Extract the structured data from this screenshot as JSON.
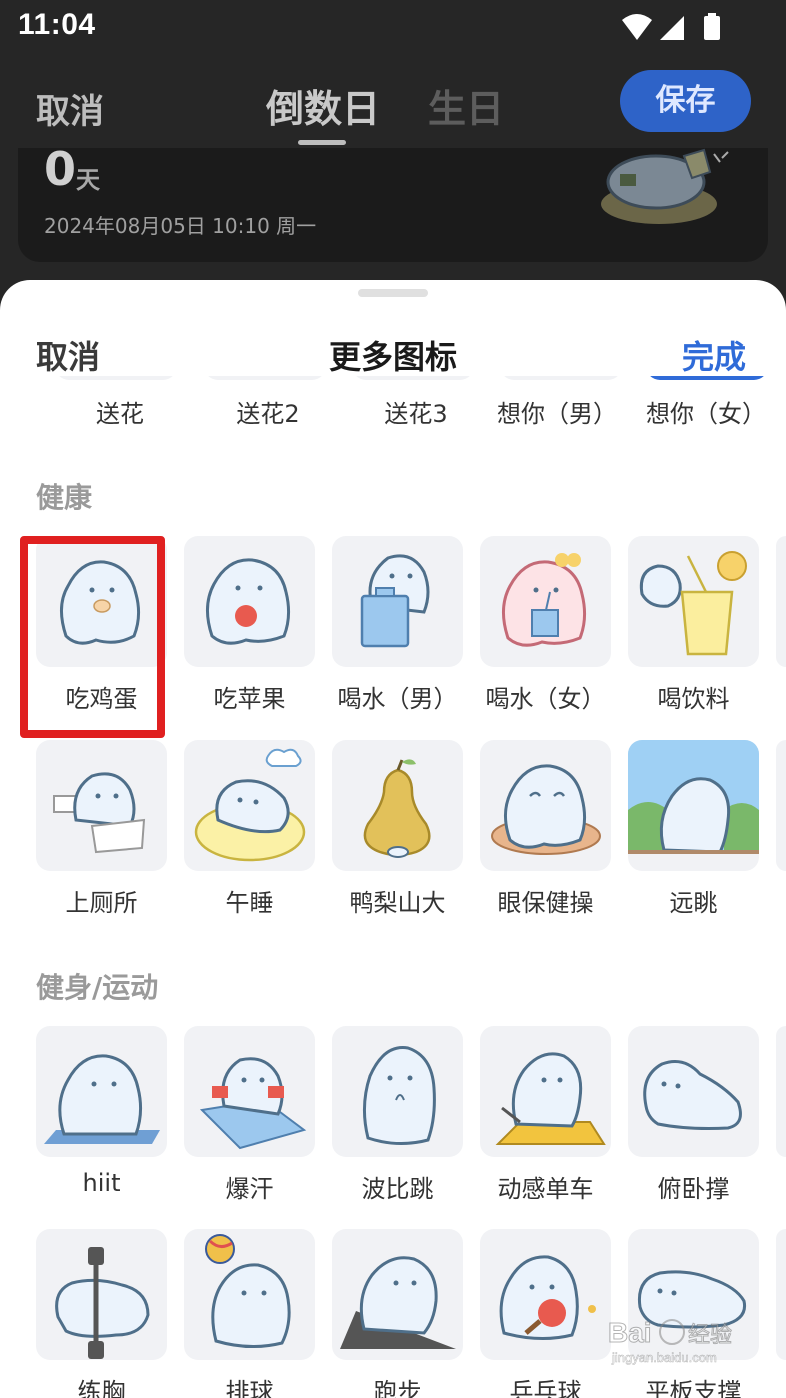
{
  "status": {
    "time": "11:04"
  },
  "topbar": {
    "cancel": "取消",
    "tabs": [
      "倒数日",
      "生日"
    ],
    "save": "保存"
  },
  "card": {
    "number": "0",
    "unit": "天",
    "date": "2024年08月05日  10:10  周一"
  },
  "sheet": {
    "cancel": "取消",
    "title": "更多图标",
    "done": "完成",
    "top_row_labels": [
      "送花",
      "送花2",
      "送花3",
      "想你（男）",
      "想你（女）"
    ],
    "sections": [
      {
        "title": "健康",
        "items": [
          "吃鸡蛋",
          "吃苹果",
          "喝水（男）",
          "喝水（女）",
          "喝饮料",
          "上厕所",
          "午睡",
          "鸭梨山大",
          "眼保健操",
          "远眺"
        ]
      },
      {
        "title": "健身/运动",
        "items": [
          "hiit",
          "爆汗",
          "波比跳",
          "动感单车",
          "俯卧撑",
          "练胸",
          "排球",
          "跑步",
          "乒乓球",
          "平板支撑"
        ]
      }
    ]
  },
  "highlight_color": "#e02020",
  "accent_color": "#2f6bd8",
  "watermark": {
    "brand": "Bai",
    "brand2": "经验",
    "url": "jingyan.baidu.com"
  }
}
